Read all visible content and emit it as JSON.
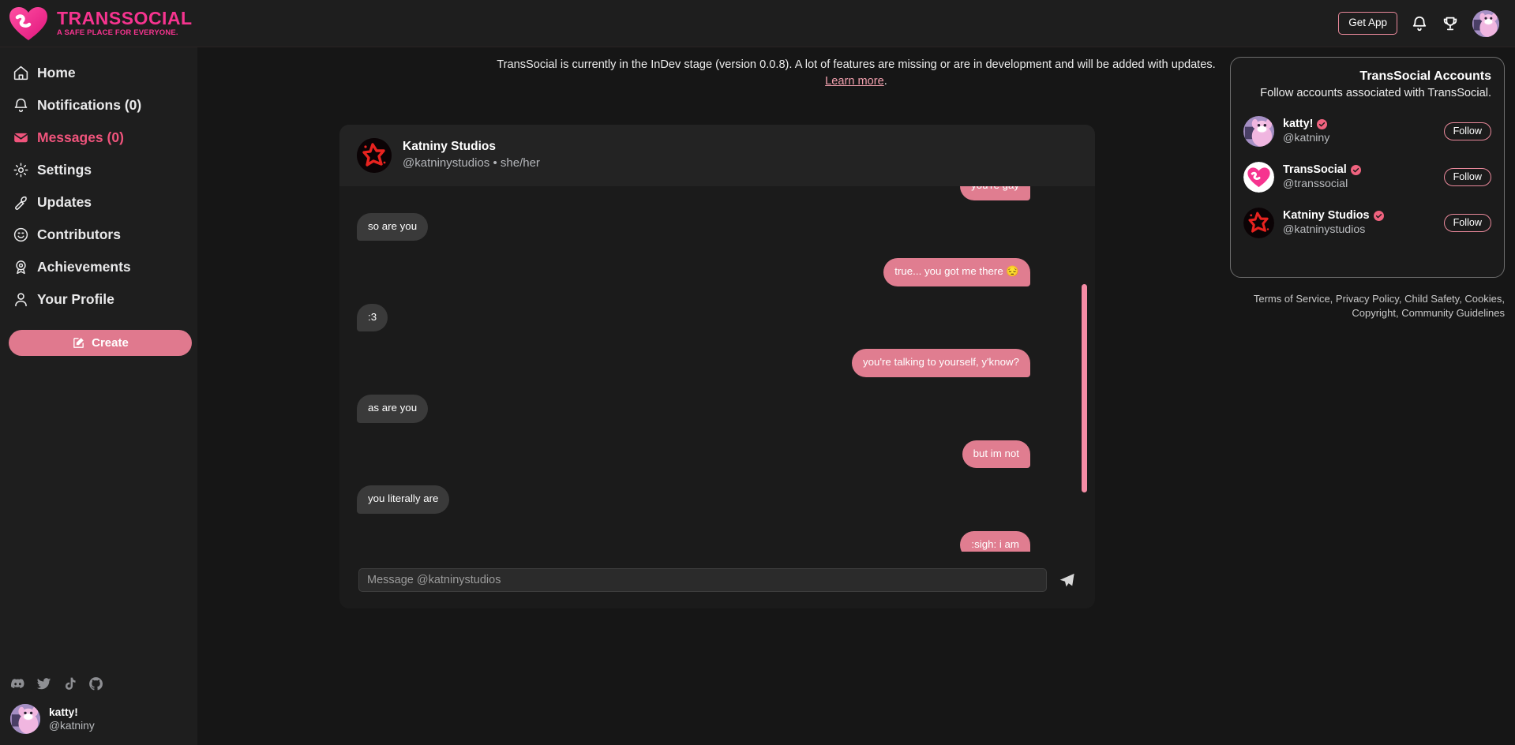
{
  "brand": {
    "name": "TRANSSOCIAL",
    "tagline": "A SAFE PLACE FOR EVERYONE.",
    "pink": "#f6348f"
  },
  "topbar": {
    "get_app_label": "Get App",
    "bell_icon": "bell-icon",
    "trophy_icon": "trophy-icon",
    "avatar_icon": "user-avatar"
  },
  "sidebar": {
    "items": [
      {
        "label": "Home",
        "icon": "home-icon",
        "active": false
      },
      {
        "label": "Notifications (0)",
        "icon": "bell-icon",
        "active": false
      },
      {
        "label": "Messages (0)",
        "icon": "envelope-icon",
        "active": true
      },
      {
        "label": "Settings",
        "icon": "gear-icon",
        "active": false
      },
      {
        "label": "Updates",
        "icon": "wrench-icon",
        "active": false
      },
      {
        "label": "Contributors",
        "icon": "smiley-icon",
        "active": false
      },
      {
        "label": "Achievements",
        "icon": "award-icon",
        "active": false
      },
      {
        "label": "Your Profile",
        "icon": "person-icon",
        "active": false
      }
    ],
    "create_label": "Create",
    "create_icon": "compose-icon",
    "socials": [
      "discord-icon",
      "twitter-icon",
      "tiktok-icon",
      "github-icon"
    ],
    "me": {
      "name": "katty!",
      "handle": "@katniny"
    }
  },
  "banner": {
    "text_before": "TransSocial is currently in the InDev stage (version 0.0.8). A lot of features are missing or are in development and will be added with updates. ",
    "link_label": "Learn more",
    "text_after": "."
  },
  "chat": {
    "name": "Katniny Studios",
    "handle": "@katninystudios",
    "separator": "•",
    "pronouns": "she/her",
    "avatar_icon": "star-avatar",
    "messages": [
      {
        "side": "out",
        "text": "you're gay"
      },
      {
        "side": "in",
        "text": "so are you"
      },
      {
        "side": "out",
        "text": "true... you got me there 😔"
      },
      {
        "side": "in",
        "text": ":3"
      },
      {
        "side": "out",
        "text": "you're talking to yourself, y'know?"
      },
      {
        "side": "in",
        "text": "as are you"
      },
      {
        "side": "out",
        "text": "but im not"
      },
      {
        "side": "in",
        "text": "you literally are"
      },
      {
        "side": "out",
        "text": ":sigh: i am"
      }
    ],
    "composer": {
      "placeholder": "Message @katninystudios",
      "value": "",
      "send_icon": "send-icon"
    },
    "bubble_out_color": "#e07d90",
    "bubble_in_color": "#3a3a3a",
    "scrollbar_color": "#f58ca5"
  },
  "right_panel": {
    "title": "TransSocial Accounts",
    "subtitle": "Follow accounts associated with TransSocial.",
    "accounts": [
      {
        "name": "katty!",
        "handle": "@katniny",
        "verified": true,
        "follow_label": "Follow",
        "avatar": "katty-avatar"
      },
      {
        "name": "TransSocial",
        "handle": "@transsocial",
        "verified": true,
        "follow_label": "Follow",
        "avatar": "transsocial-logo-avatar"
      },
      {
        "name": "Katniny Studios",
        "handle": "@katninystudios",
        "verified": true,
        "follow_label": "Follow",
        "avatar": "star-avatar"
      }
    ]
  },
  "legal": {
    "line1": "Terms of Service, Privacy Policy, Child Safety, Cookies,",
    "line2": "Copyright, Community Guidelines"
  }
}
